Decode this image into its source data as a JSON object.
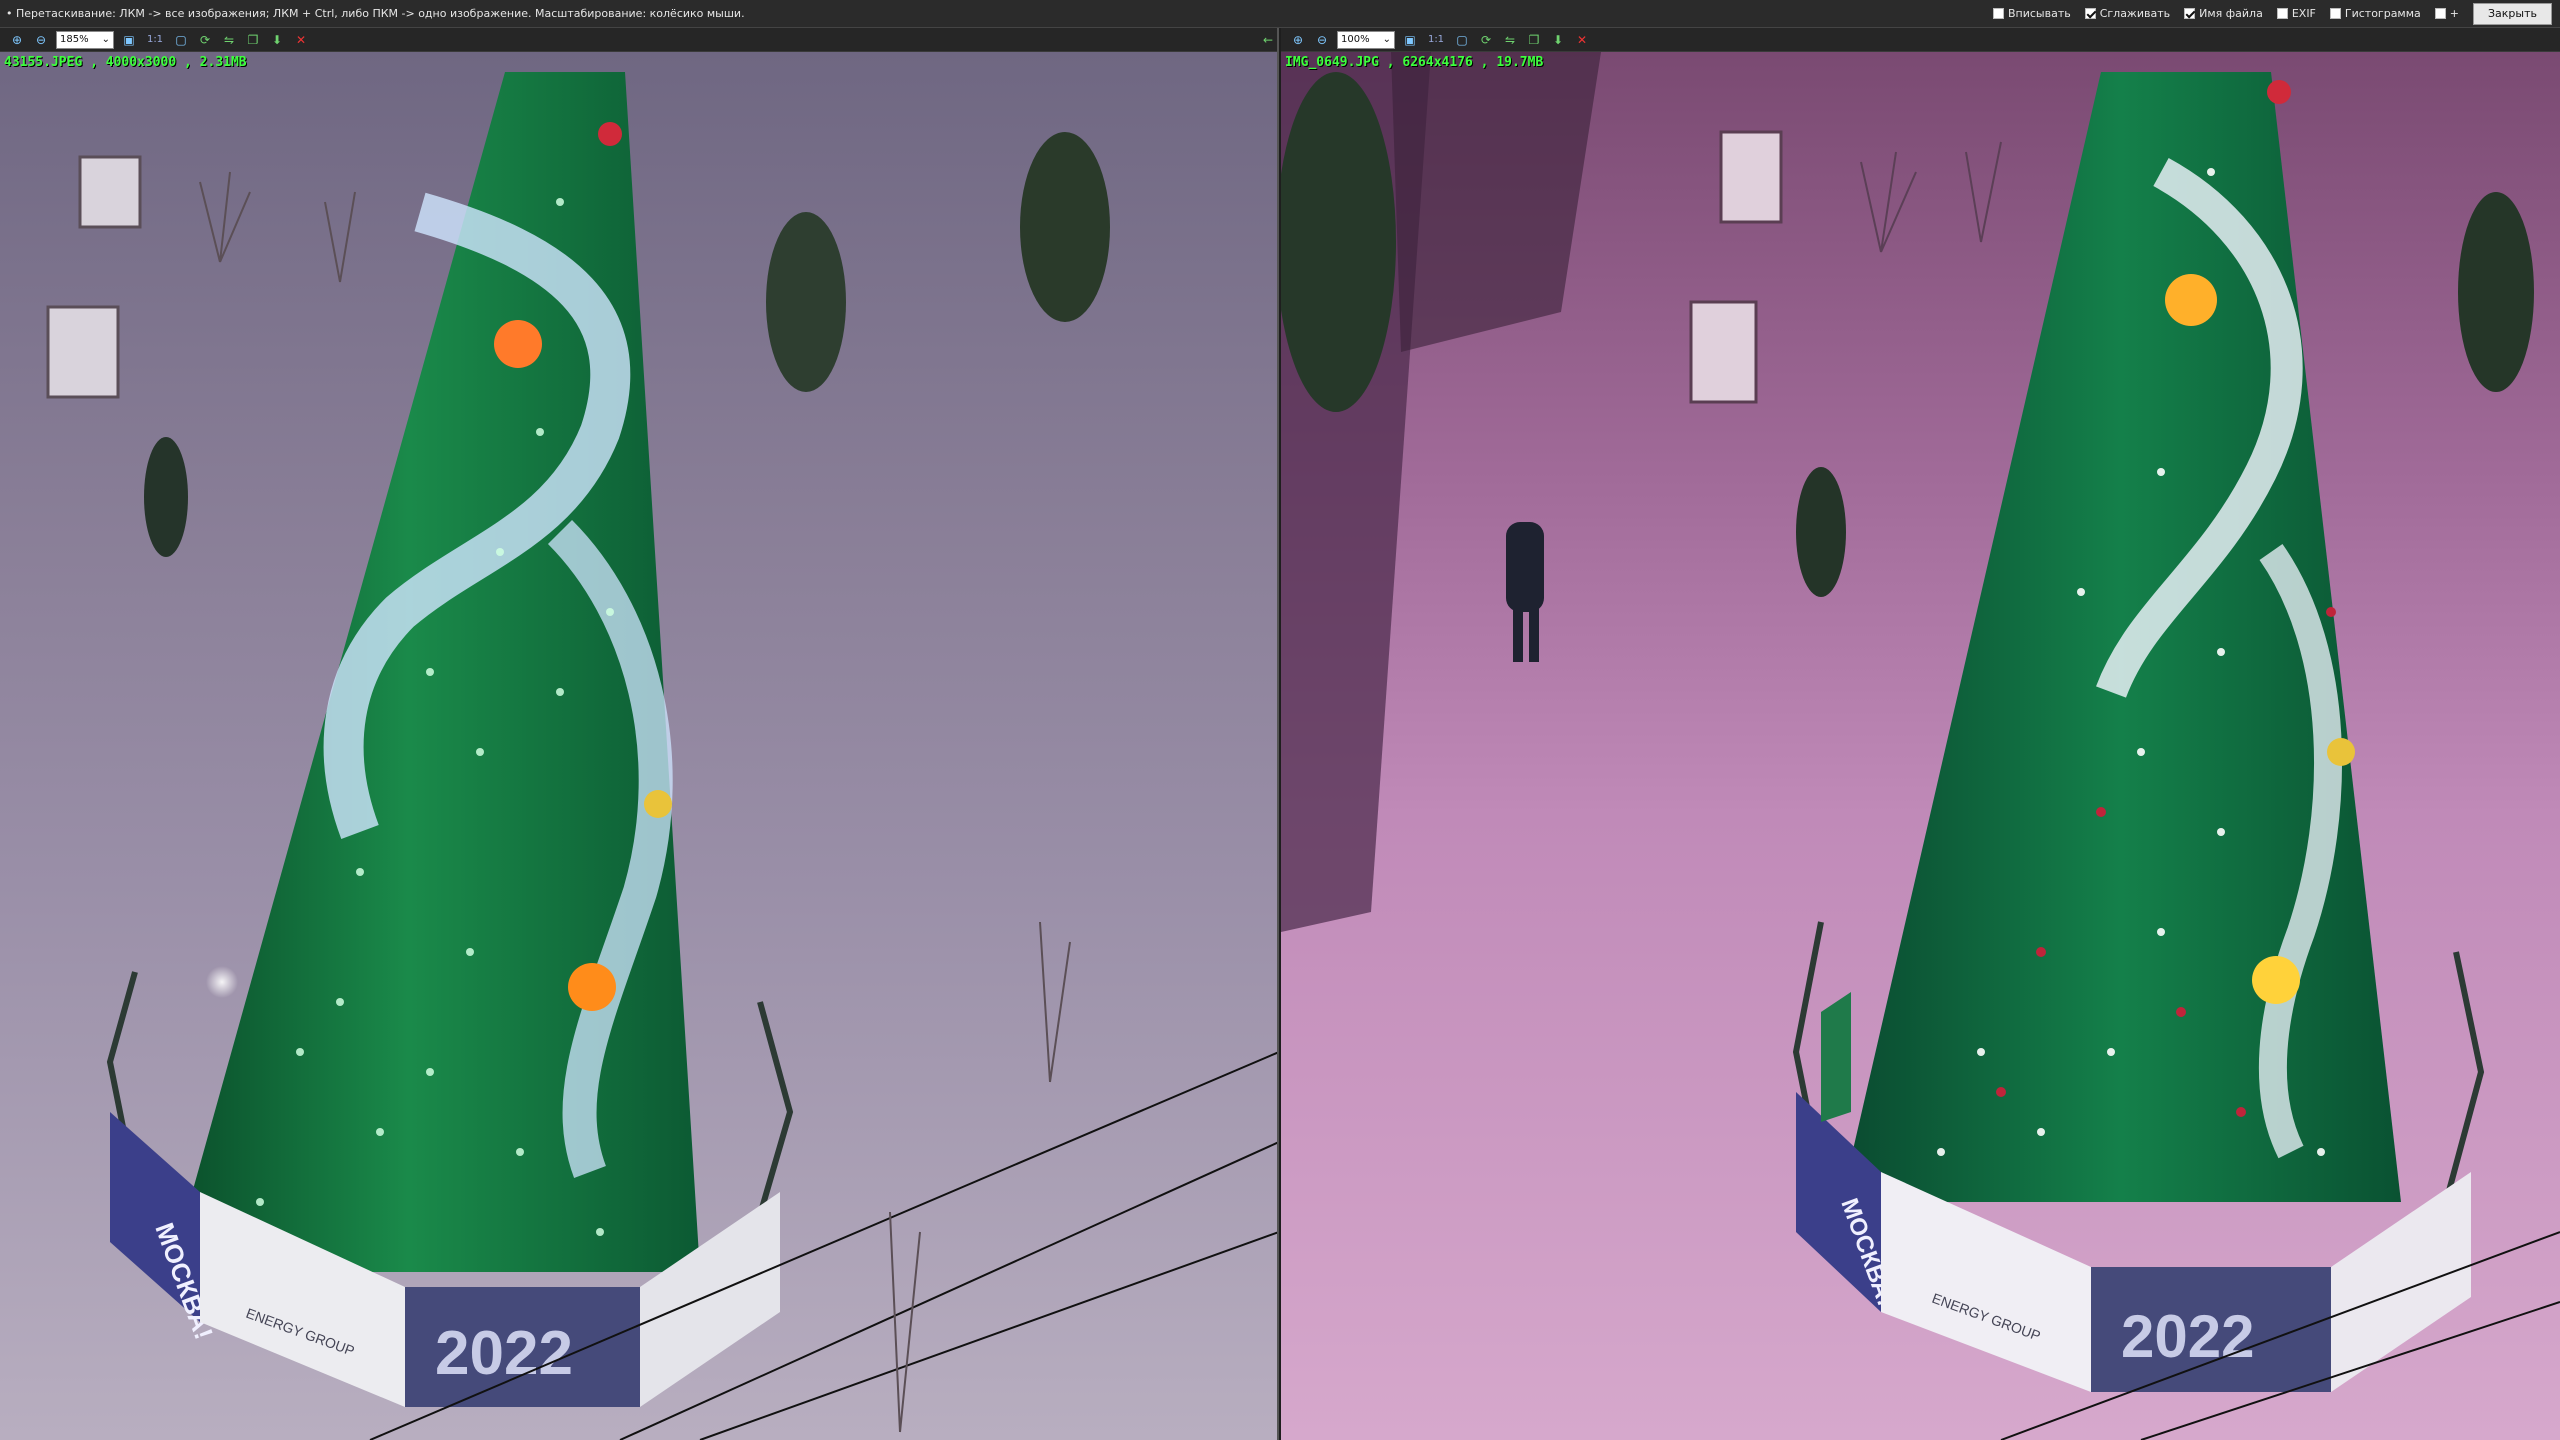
{
  "titlebar": {
    "hint": "• Перетаскивание: ЛКМ -> все изображения; ЛКМ + Ctrl, либо ПКМ -> одно изображение. Масштабирование: колёсико мыши.",
    "options": [
      {
        "label": "Вписывать",
        "checked": false
      },
      {
        "label": "Сглаживать",
        "checked": true
      },
      {
        "label": "Имя файла",
        "checked": true
      },
      {
        "label": "EXIF",
        "checked": false
      },
      {
        "label": "Гистограмма",
        "checked": false
      },
      {
        "label": "+",
        "checked": false
      }
    ],
    "close_label": "Закрыть"
  },
  "panels": [
    {
      "zoom": "185%",
      "file_info": "43155.JPEG , 4000x3000 , 2.31MB",
      "banner_text": "2022",
      "side_banner": "МОСКВА!",
      "logo_text": "ENERGY GROUP"
    },
    {
      "zoom": "100%",
      "file_info": "IMG_0649.JPG , 6264x4176 , 19.7MB",
      "banner_text": "2022",
      "side_banner": "МОСКВА!",
      "logo_text": "ENERGY GROUP"
    }
  ],
  "toolbar_icons": [
    "zoom-in-icon",
    "zoom-out-icon",
    "zoom-select",
    "fit-icon",
    "actual-size-icon",
    "fullscreen-icon",
    "rotate-icon",
    "flip-icon",
    "copy-icon",
    "save-icon",
    "close-panel-icon"
  ],
  "toolbar_labels": {
    "actual_size": "1:1"
  },
  "colors": {
    "file_info": "#3dff3d",
    "tree_green": "#0e6b3a",
    "light_white": "#e8f4ff",
    "banner_blue": "#3b3f8a"
  }
}
